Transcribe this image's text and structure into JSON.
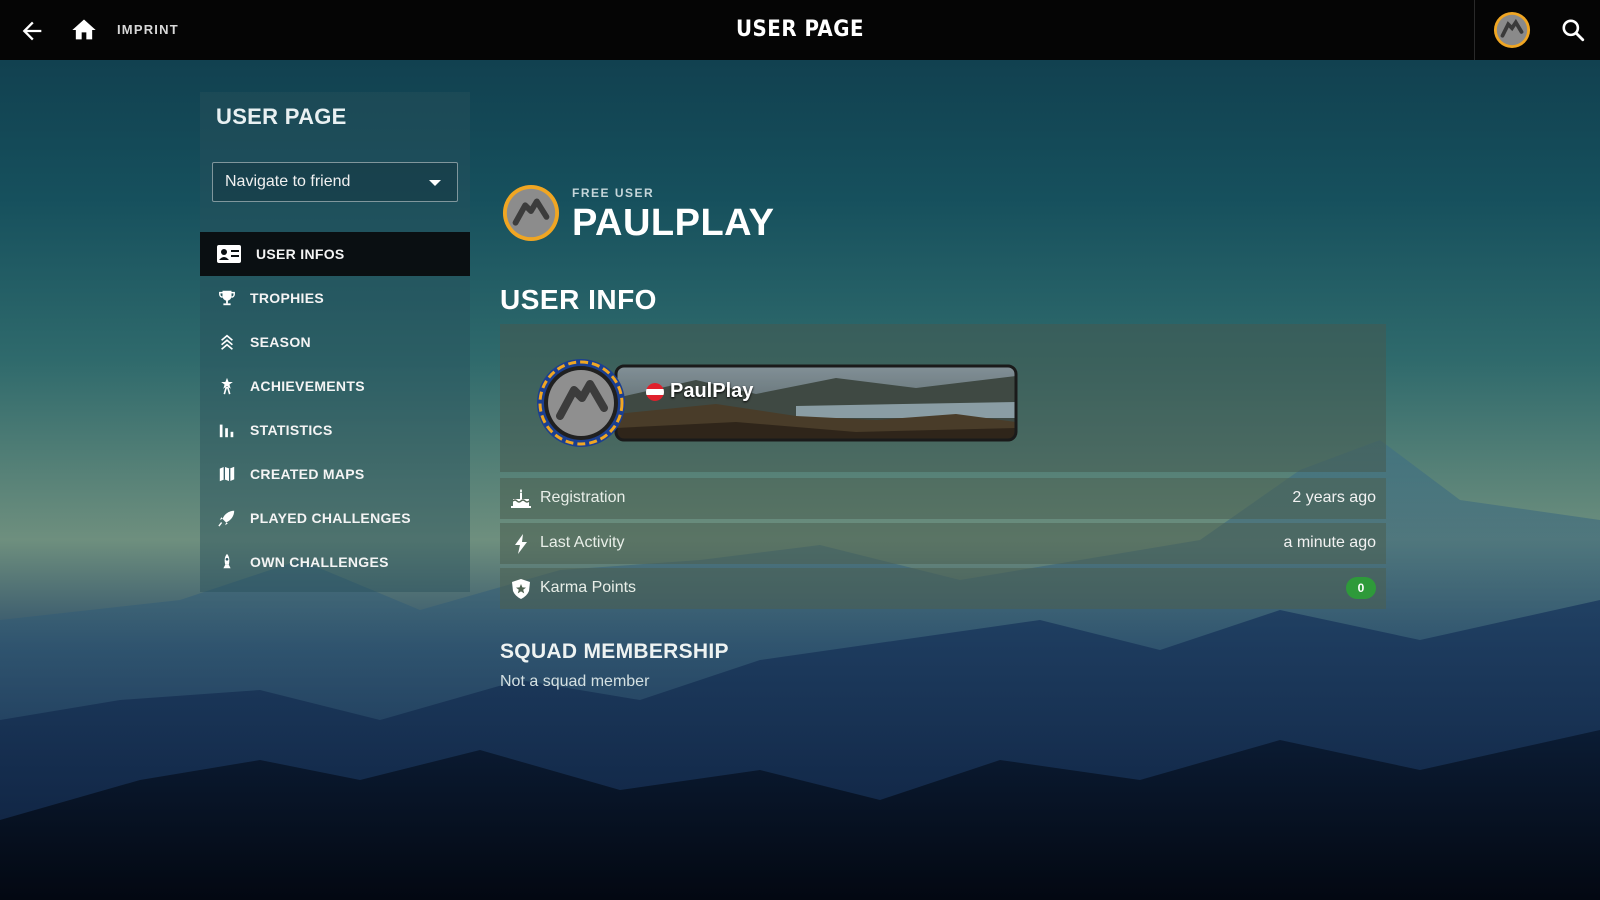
{
  "topbar": {
    "imprint_label": "IMPRINT",
    "title": "USER PAGE",
    "icons": [
      "back-arrow-icon",
      "home-icon",
      "avatar",
      "search-icon"
    ]
  },
  "sidebar": {
    "title": "USER PAGE",
    "navigate_select": {
      "value": "Navigate to friend"
    },
    "items": [
      {
        "label": "USER INFOS",
        "icon": "id-card-icon",
        "active": true
      },
      {
        "label": "TROPHIES",
        "icon": "trophy-icon"
      },
      {
        "label": "SEASON",
        "icon": "chevron-rank-icon"
      },
      {
        "label": "ACHIEVEMENTS",
        "icon": "star-person-icon"
      },
      {
        "label": "STATISTICS",
        "icon": "bar-chart-icon"
      },
      {
        "label": "CREATED MAPS",
        "icon": "map-icon"
      },
      {
        "label": "PLAYED CHALLENGES",
        "icon": "rocket-icon"
      },
      {
        "label": "OWN CHALLENGES",
        "icon": "person-rocket-icon"
      }
    ]
  },
  "profile": {
    "role": "FREE USER",
    "name": "PAULPLAY",
    "banner_name": "PaulPlay"
  },
  "user_info": {
    "section_title": "USER INFO",
    "rows": [
      {
        "label": "Registration",
        "value": "2 years ago",
        "icon": "cake-icon"
      },
      {
        "label": "Last Activity",
        "value": "a minute ago",
        "icon": "lightning-icon"
      },
      {
        "label": "Karma Points",
        "value": "0",
        "icon": "karma-shield-icon"
      }
    ]
  },
  "squad": {
    "title": "SQUAD MEMBERSHIP",
    "status": "Not a squad member"
  },
  "colors": {
    "topbar": "#050505",
    "active_menu": "#0a0f12",
    "karma_badge": "#2e9a3a",
    "avatar_ring": "#f0a623"
  }
}
